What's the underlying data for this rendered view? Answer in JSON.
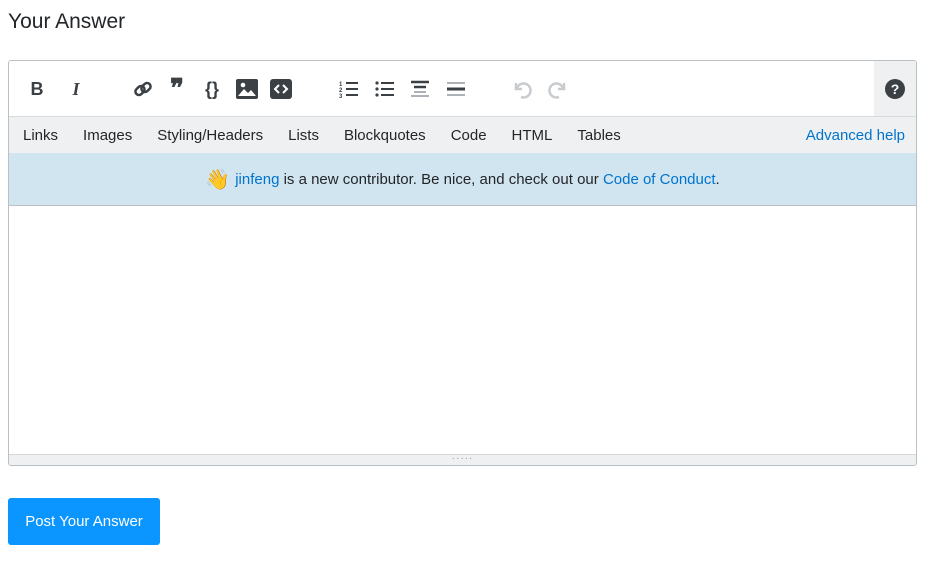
{
  "title": "Your Answer",
  "toolbar": {
    "bold": "B",
    "italic": "I",
    "help": "?"
  },
  "tabs": [
    "Links",
    "Images",
    "Styling/Headers",
    "Lists",
    "Blockquotes",
    "Code",
    "HTML",
    "Tables"
  ],
  "advanced_help": "Advanced help",
  "notice": {
    "user": "jinfeng",
    "text": " is a new contributor. Be nice, and check out our ",
    "link": "Code of Conduct",
    "end": "."
  },
  "post_button": "Post Your Answer"
}
